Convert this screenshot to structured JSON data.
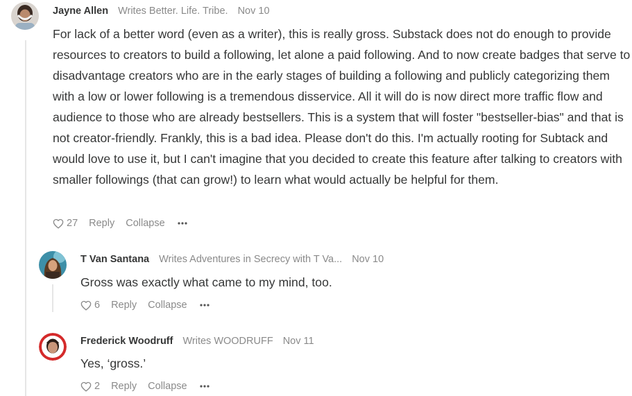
{
  "comments": [
    {
      "author": "Jayne Allen",
      "writes": "Writes Better. Life. Tribe.",
      "date": "Nov 10",
      "body": "For lack of a better word (even as a writer), this is really gross. Substack does not do enough to provide resources to creators to build a following, let alone a paid following. And to now create badges that serve to disadvantage creators who are in the early stages of building a following and publicly categorizing them with a low or lower following is a tremendous disservice. All it will do is now direct more traffic flow and audience to those who are already bestsellers. This is a system that will foster \"bestseller-bias\" and that is not creator-friendly. Frankly, this is a bad idea. Please don't do this. I'm actually rooting for Subtack and would love to use it, but I can't imagine that you decided to create this feature after talking to creators with smaller followings (that can grow!) to learn what would actually be helpful for them.",
      "likes": "27",
      "reply_label": "Reply",
      "collapse_label": "Collapse",
      "more_icon": "ellipsis-icon"
    },
    {
      "author": "T Van Santana",
      "writes": "Writes Adventures in Secrecy with T Va...",
      "date": "Nov 10",
      "body": "Gross was exactly what came to my mind, too.",
      "likes": "6",
      "reply_label": "Reply",
      "collapse_label": "Collapse",
      "more_icon": "ellipsis-icon"
    },
    {
      "author": "Frederick Woodruff",
      "writes": "Writes WOODRUFF",
      "date": "Nov 11",
      "body": "Yes, ‘gross.’",
      "likes": "2",
      "reply_label": "Reply",
      "collapse_label": "Collapse",
      "more_icon": "ellipsis-icon"
    }
  ],
  "colors": {
    "text": "#363737",
    "muted": "#8a8a8a",
    "thread_line": "#e6e6e6"
  }
}
